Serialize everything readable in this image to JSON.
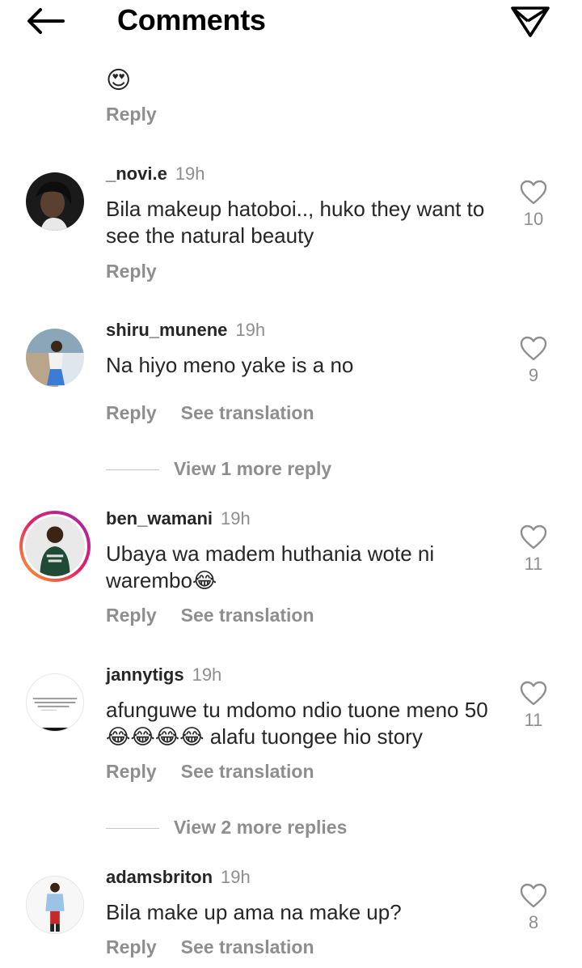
{
  "header": {
    "title": "Comments"
  },
  "top_comment": {
    "emoji": "😍",
    "reply_label": "Reply"
  },
  "actions": {
    "reply": "Reply",
    "see_translation": "See translation"
  },
  "comments": [
    {
      "username": "_novi.e",
      "time": "19h",
      "text": "Bila makeup hatoboi.., huko they want to see the natural beauty",
      "likes": "10"
    },
    {
      "username": "shiru_munene",
      "time": "19h",
      "text": "Na hiyo meno yake is a no",
      "likes": "9"
    },
    {
      "username": "ben_wamani",
      "time": "19h",
      "text": "Ubaya wa madem huthania wote ni warembo😂",
      "likes": "11"
    },
    {
      "username": "jannytigs",
      "time": "19h",
      "text": "afunguwe tu mdomo ndio tuone meno 50 😂😂😂😂 alafu tuongee hio story",
      "likes": "11"
    },
    {
      "username": "adamsbriton",
      "time": "19h",
      "text": "Bila make up ama na make up?",
      "likes": "8"
    }
  ],
  "view_more": [
    {
      "label": "View 1 more reply"
    },
    {
      "label": "View 2 more replies"
    }
  ]
}
